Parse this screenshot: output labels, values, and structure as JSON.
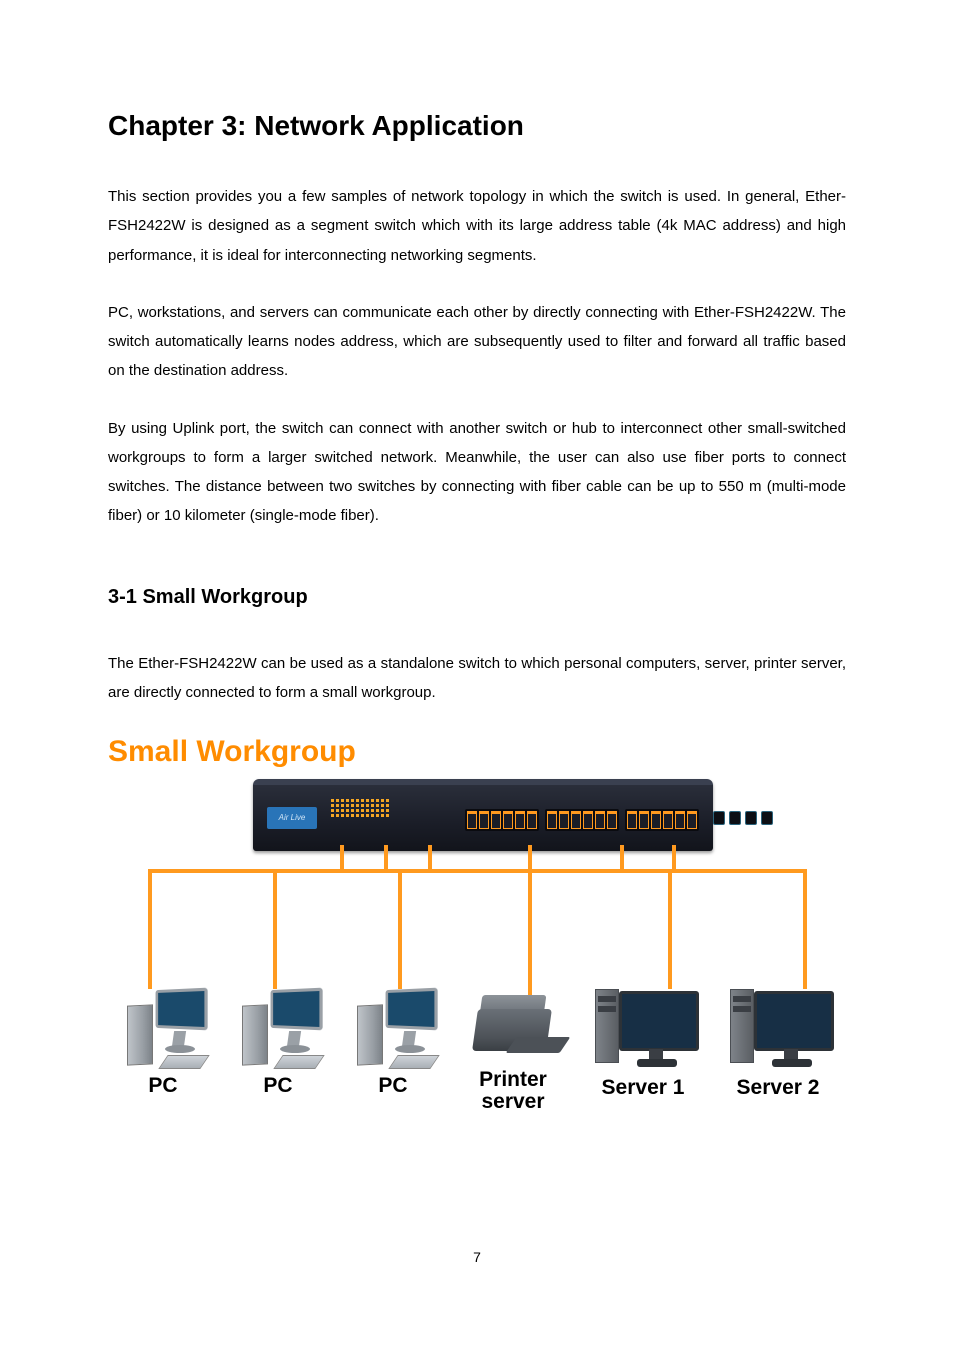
{
  "chapter_title": "Chapter 3: Network Application",
  "paragraphs": {
    "p1": "This section provides you a few samples of network topology in which the switch is used. In general, Ether-FSH2422W is designed as a segment switch which with its large address table (4k MAC address) and high performance, it is ideal for interconnecting networking segments.",
    "p2": "PC, workstations, and servers can communicate each other by directly connecting with Ether-FSH2422W. The switch automatically learns nodes address, which are subsequently used to filter and forward all traffic based on the destination address.",
    "p3": "By using Uplink port, the switch can connect with another switch or hub to interconnect other small-switched workgroups to form a larger switched network. Meanwhile, the user can also use fiber ports to connect switches. The distance between two switches by connecting with fiber cable can be up to 550 m (multi-mode fiber) or 10 kilometer (single-mode fiber)."
  },
  "section_title": "3-1 Small Workgroup",
  "section_body": "The Ether-FSH2422W can be used as a standalone switch to which personal computers, server, printer server, are directly connected to form a small workgroup.",
  "diagram": {
    "title": "Small Workgroup",
    "switch_brand": "Air Live",
    "devices": [
      {
        "type": "pc",
        "label": "PC"
      },
      {
        "type": "pc",
        "label": "PC"
      },
      {
        "type": "pc",
        "label": "PC"
      },
      {
        "type": "printer",
        "label": "Printer\nserver"
      },
      {
        "type": "server",
        "label": "Server 1"
      },
      {
        "type": "server",
        "label": "Server 2"
      }
    ]
  },
  "page_number": "7"
}
